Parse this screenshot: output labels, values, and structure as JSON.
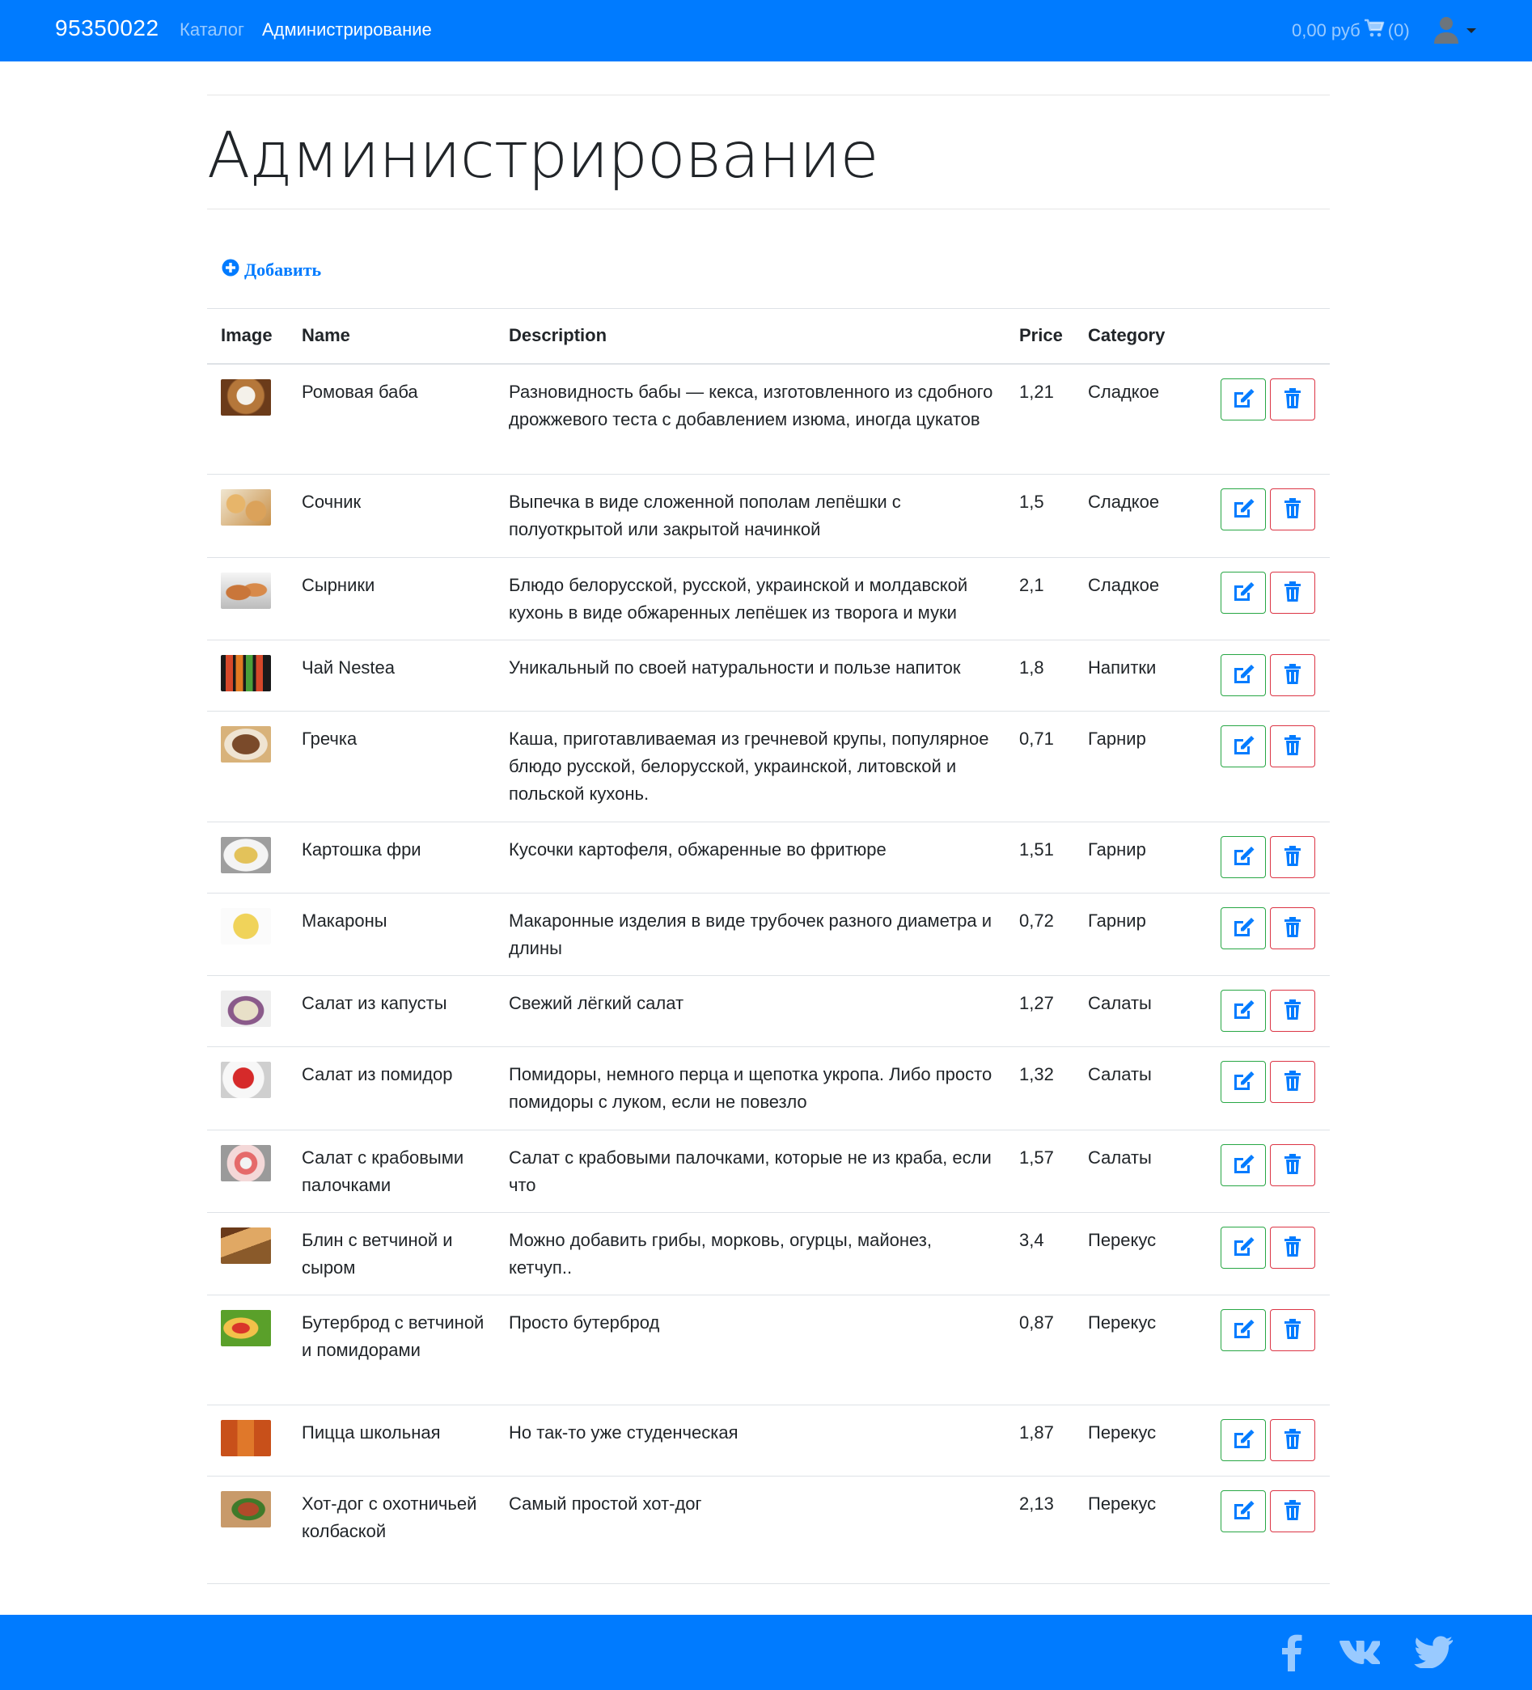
{
  "navbar": {
    "brand": "95350022",
    "links": [
      "Каталог",
      "Администрирование"
    ],
    "cart_total": "0,00 руб",
    "cart_count": "(0)"
  },
  "page": {
    "title": "Администрирование",
    "add_label": "Добавить"
  },
  "table": {
    "headers": [
      "Image",
      "Name",
      "Description",
      "Price",
      "Category"
    ],
    "rows": [
      {
        "name": "Ромовая баба",
        "description": "Разновидность бабы — кекса, изготовленного из сдобного дрожжевого теста с добавлением изюма, иногда цукатов",
        "price": "1,21",
        "category": "Сладкое"
      },
      {
        "name": "Сочник",
        "description": "Выпечка в виде сложенной пополам лепёшки с полуоткрытой или закрытой начинкой",
        "price": "1,5",
        "category": "Сладкое"
      },
      {
        "name": "Сырники",
        "description": "Блюдо белорусской, русской, украинской и молдавской кухонь в виде обжаренных лепёшек из творога и муки",
        "price": "2,1",
        "category": "Сладкое"
      },
      {
        "name": "Чай Nestea",
        "description": "Уникальный по своей натуральности и пользе напиток",
        "price": "1,8",
        "category": "Напитки"
      },
      {
        "name": "Гречка",
        "description": "Каша, приготавливаемая из гречневой крупы, популярное блюдо русской, белорусской, украинской, литовской и польской кухонь.",
        "price": "0,71",
        "category": "Гарнир"
      },
      {
        "name": "Картошка фри",
        "description": "Кусочки картофеля, обжаренные во фритюре",
        "price": "1,51",
        "category": "Гарнир"
      },
      {
        "name": "Макароны",
        "description": "Макаронные изделия в виде трубочек разного диаметра и длины",
        "price": "0,72",
        "category": "Гарнир"
      },
      {
        "name": "Салат из капусты",
        "description": "Свежий лёгкий салат",
        "price": "1,27",
        "category": "Салаты"
      },
      {
        "name": "Салат из помидор",
        "description": "Помидоры, немного перца и щепотка укропа. Либо просто помидоры с луком, если не повезло",
        "price": "1,32",
        "category": "Салаты"
      },
      {
        "name": "Салат с крабовыми палочками",
        "description": "Салат с крабовыми палочками, которые не из краба, если что",
        "price": "1,57",
        "category": "Салаты"
      },
      {
        "name": "Блин с ветчиной и сыром",
        "description": "Можно добавить грибы, морковь, огурцы, майонез, кетчуп..",
        "price": "3,4",
        "category": "Перекус"
      },
      {
        "name": "Бутерброд с ветчиной и помидорами",
        "description": "Просто бутерброд",
        "price": "0,87",
        "category": "Перекус"
      },
      {
        "name": "Пицца школьная",
        "description": "Но так-то уже студенческая",
        "price": "1,87",
        "category": "Перекус"
      },
      {
        "name": "Хот-дог с охотничьей колбаской",
        "description": "Самый простой хот-дог",
        "price": "2,13",
        "category": "Перекус"
      }
    ]
  },
  "colors": {
    "primary": "#007bff",
    "success": "#28a745",
    "danger": "#dc3545"
  },
  "icons": {
    "edit": "edit-icon",
    "delete": "trash-icon",
    "add": "plus-circle-icon",
    "cart": "cart-icon",
    "user": "user-icon",
    "social": [
      "facebook-icon",
      "vk-icon",
      "twitter-icon"
    ]
  }
}
